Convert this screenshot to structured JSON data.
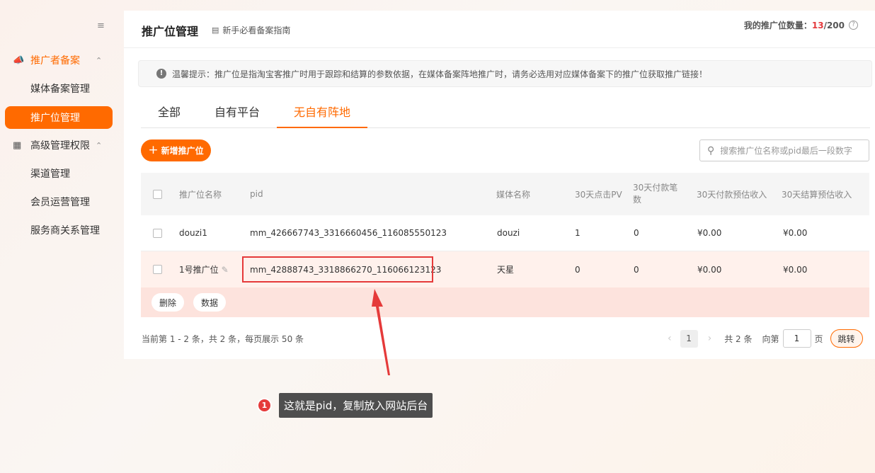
{
  "sidebar": {
    "groups": [
      {
        "label": "推广者备案",
        "items": [
          "媒体备案管理",
          "推广位管理"
        ]
      },
      {
        "label": "高级管理权限",
        "items": [
          "渠道管理",
          "会员运营管理",
          "服务商关系管理"
        ]
      }
    ],
    "collapse_icon": "menu-icon"
  },
  "header": {
    "title": "推广位管理",
    "guide_link": "新手必看备案指南",
    "quota_label": "我的推广位数量：",
    "quota_used": "13",
    "quota_total": "/200"
  },
  "notice": {
    "text": "温馨提示：推广位是指淘宝客推广时用于跟踪和结算的参数依据，在媒体备案阵地推广时，请务必选用对应媒体备案下的推广位获取推广链接！"
  },
  "tabs": [
    "全部",
    "自有平台",
    "无自有阵地"
  ],
  "active_tab": "无自有阵地",
  "toolbar": {
    "add_button": "新增推广位",
    "search_placeholder": "搜索推广位名称或pid最后一段数字"
  },
  "table": {
    "columns": [
      "推广位名称",
      "pid",
      "媒体名称",
      "30天点击PV",
      "30天付款笔数",
      "30天付款预估收入",
      "30天结算预估收入"
    ],
    "rows": [
      {
        "name": "douzi1",
        "pid": "mm_426667743_3316660456_116085550123",
        "media": "douzi",
        "pv": "1",
        "orders": "0",
        "pay_income": "¥0.00",
        "settle_income": "¥0.00"
      },
      {
        "name": "1号推广位",
        "pid": "mm_42888743_3318866270_116066123123",
        "media": "天星",
        "pv": "0",
        "orders": "0",
        "pay_income": "¥0.00",
        "settle_income": "¥0.00"
      }
    ],
    "row_actions": [
      "删除",
      "数据"
    ]
  },
  "footer": {
    "summary": "当前第 1 - 2 条，共 2 条，每页展示 50 条",
    "current_page": "1",
    "total_text": "共 2 条",
    "goto_label": "向第",
    "goto_value": "1",
    "page_unit": "页",
    "jump_button": "跳转"
  },
  "annotation": {
    "number": "1",
    "text": "这就是pid，复制放入网站后台"
  },
  "colors": {
    "accent": "#ff6a00",
    "highlight": "#e53a3a"
  }
}
